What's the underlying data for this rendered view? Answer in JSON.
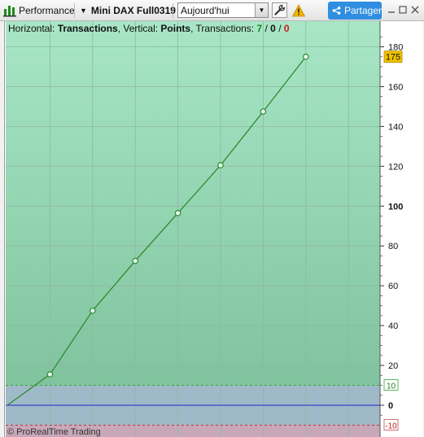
{
  "toolbar": {
    "performance_label": "Performance",
    "instrument_label": "Mini DAX Full0319",
    "period_value": "Aujourd'hui",
    "share_label": "Partager",
    "icons": [
      "performance-chart-icon",
      "dropdown-caret-icon",
      "wrench-icon",
      "warning-icon",
      "share-icon",
      "minimize-icon",
      "maximize-icon",
      "close-icon"
    ]
  },
  "info": {
    "horizontal_label": "Horizontal: ",
    "horizontal_value": "Transactions",
    "vertical_label": ", Vertical: ",
    "vertical_value": "Points",
    "transactions_label": ", Transactions: ",
    "count_green": "7",
    "sep1": " / ",
    "count_black": "0",
    "sep2": " / ",
    "count_red": "0"
  },
  "footer": {
    "text": "© ProRealTime Trading"
  },
  "colors": {
    "line": "#2e8b2e",
    "zero_line": "#2222cc",
    "last_value_badge": "#f2c200",
    "profit_zone_top": "#a8e6c6",
    "profit_zone_bottom": "#80c39e",
    "neutral_zone": "#9fb9c8",
    "loss_zone": "#c8a8b8"
  },
  "chart_data": {
    "type": "line",
    "x": [
      0,
      1,
      2,
      3,
      4,
      5,
      6,
      7
    ],
    "y": [
      0,
      15.5,
      47.5,
      72.5,
      96.5,
      120.5,
      147.5,
      175
    ],
    "ylim": [
      -10,
      190
    ],
    "y_ticks": [
      180,
      160,
      140,
      120,
      100,
      80,
      60,
      40,
      20,
      0
    ],
    "y_tick_labels": [
      "180",
      "160",
      "140",
      "120",
      "100",
      "80",
      "60",
      "40",
      "20",
      "0"
    ],
    "upper_threshold": 10,
    "lower_threshold": -10,
    "upper_threshold_label": "10",
    "lower_threshold_label": "-10",
    "last_value_label": "175",
    "grid": true
  }
}
